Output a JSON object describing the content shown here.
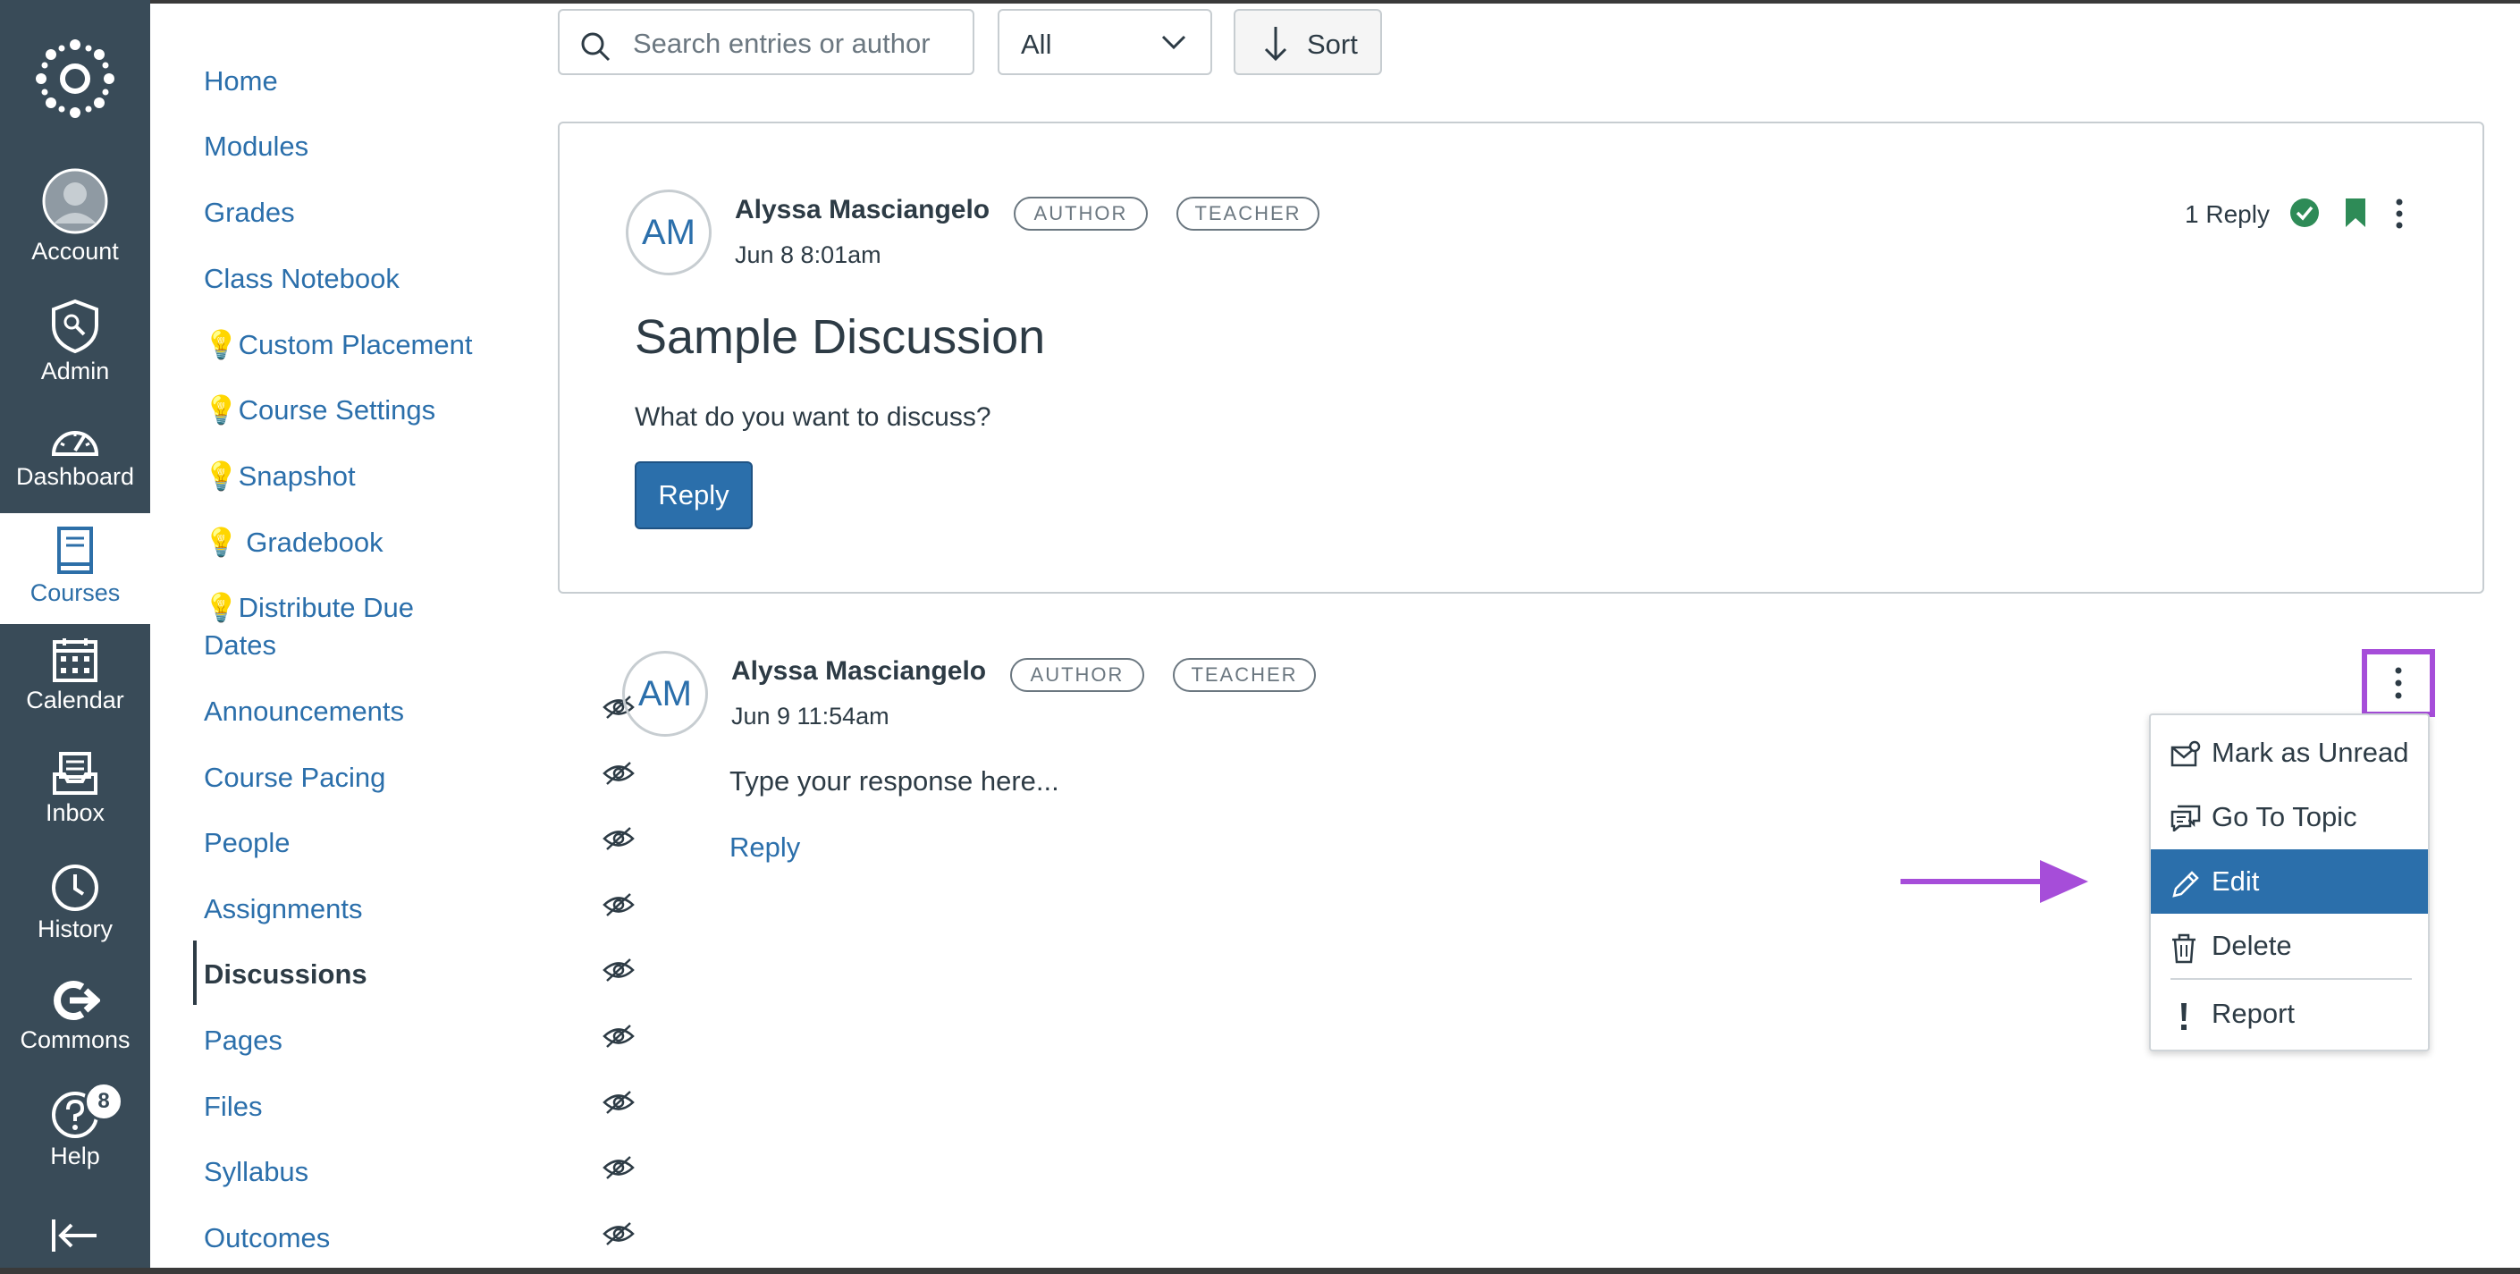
{
  "global_nav": {
    "items": [
      {
        "label": "Account",
        "icon": "account-avatar-icon"
      },
      {
        "label": "Admin",
        "icon": "admin-shield-icon"
      },
      {
        "label": "Dashboard",
        "icon": "dashboard-gauge-icon"
      },
      {
        "label": "Courses",
        "icon": "courses-book-icon",
        "active": true
      },
      {
        "label": "Calendar",
        "icon": "calendar-icon"
      },
      {
        "label": "Inbox",
        "icon": "inbox-icon"
      },
      {
        "label": "History",
        "icon": "history-clock-icon"
      },
      {
        "label": "Commons",
        "icon": "commons-icon"
      },
      {
        "label": "Help",
        "icon": "help-icon",
        "badge": "8"
      }
    ]
  },
  "course_nav": {
    "items": [
      {
        "label": "Home"
      },
      {
        "label": "Modules"
      },
      {
        "label": "Grades"
      },
      {
        "label": "Class Notebook"
      },
      {
        "label": "💡Custom Placement"
      },
      {
        "label": "💡Course Settings"
      },
      {
        "label": "💡Snapshot"
      },
      {
        "label": "💡 Gradebook"
      },
      {
        "label": "💡Distribute Due",
        "label2": "Dates"
      },
      {
        "label": "Announcements",
        "hidden": true
      },
      {
        "label": "Course Pacing",
        "hidden": true
      },
      {
        "label": "People",
        "hidden": true
      },
      {
        "label": "Assignments",
        "hidden": true
      },
      {
        "label": "Discussions",
        "hidden": true,
        "active": true
      },
      {
        "label": "Pages",
        "hidden": true
      },
      {
        "label": "Files",
        "hidden": true
      },
      {
        "label": "Syllabus",
        "hidden": true
      },
      {
        "label": "Outcomes",
        "hidden": true
      }
    ]
  },
  "toolbar": {
    "search_placeholder": "Search entries or author",
    "filter_value": "All",
    "sort_label": "Sort"
  },
  "topic": {
    "avatar_initials": "AM",
    "author": "Alyssa Masciangelo",
    "badges": [
      "AUTHOR",
      "TEACHER"
    ],
    "date": "Jun 8 8:01am",
    "reply_count": "1 Reply",
    "title": "Sample Discussion",
    "message": "What do you want to discuss?",
    "reply_button": "Reply"
  },
  "entry": {
    "avatar_initials": "AM",
    "author": "Alyssa Masciangelo",
    "badges": [
      "AUTHOR",
      "TEACHER"
    ],
    "date": "Jun 9 11:54am",
    "message": "Type your response here...",
    "reply_link": "Reply"
  },
  "entry_menu": {
    "items": [
      {
        "label": "Mark as Unread",
        "icon": "mark-unread-icon"
      },
      {
        "label": "Go To Topic",
        "icon": "go-to-topic-icon"
      },
      {
        "label": "Edit",
        "icon": "pencil-icon",
        "selected": true
      },
      {
        "label": "Delete",
        "icon": "trash-icon"
      },
      {
        "label": "Report",
        "icon": "exclamation-icon"
      }
    ]
  },
  "colors": {
    "nav_bg": "#394b58",
    "link_blue": "#2b6fab",
    "highlight_purple": "#a64dd9",
    "success_green": "#2e8b57"
  }
}
